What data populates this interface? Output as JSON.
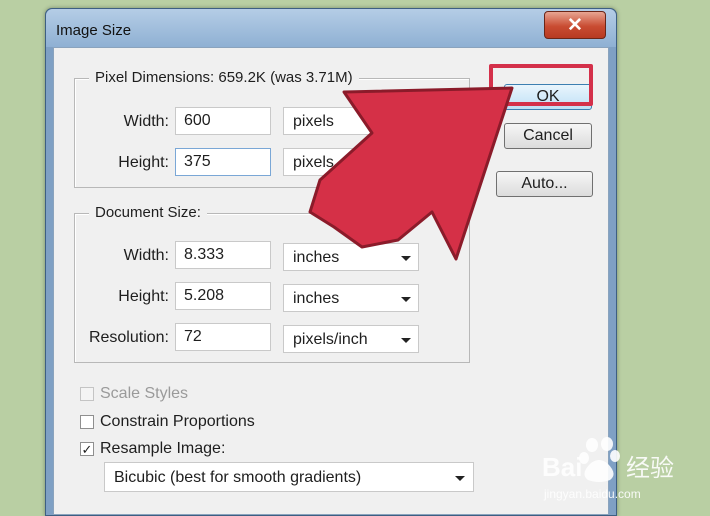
{
  "window": {
    "title": "Image Size",
    "close_glyph": "✕"
  },
  "pixel_dimensions": {
    "legend": "Pixel Dimensions:  659.2K (was 3.71M)",
    "width_label": "Width:",
    "width_value": "600",
    "width_unit": "pixels",
    "height_label": "Height:",
    "height_value": "375",
    "height_unit": "pixels"
  },
  "document_size": {
    "legend": "Document Size:",
    "width_label": "Width:",
    "width_value": "8.333",
    "width_unit": "inches",
    "height_label": "Height:",
    "height_value": "5.208",
    "height_unit": "inches",
    "resolution_label": "Resolution:",
    "resolution_value": "72",
    "resolution_unit": "pixels/inch"
  },
  "buttons": {
    "ok": "OK",
    "cancel": "Cancel",
    "auto": "Auto..."
  },
  "options": {
    "scale_styles": {
      "label": "Scale Styles",
      "checked": false,
      "enabled": false
    },
    "constrain_proportions": {
      "label": "Constrain Proportions",
      "checked": false,
      "enabled": true
    },
    "resample_image": {
      "label": "Resample Image:",
      "checked": true,
      "enabled": true
    },
    "resample_method": "Bicubic (best for smooth gradients)",
    "check_glyph": "✓"
  },
  "watermark": {
    "brand": "Bai",
    "brand_suffix": "经验",
    "url": "jingyan.baidu.com"
  },
  "colors": {
    "highlight": "#d4304a",
    "arrow_fill": "#d53047",
    "arrow_stroke": "#8b1b2a"
  }
}
